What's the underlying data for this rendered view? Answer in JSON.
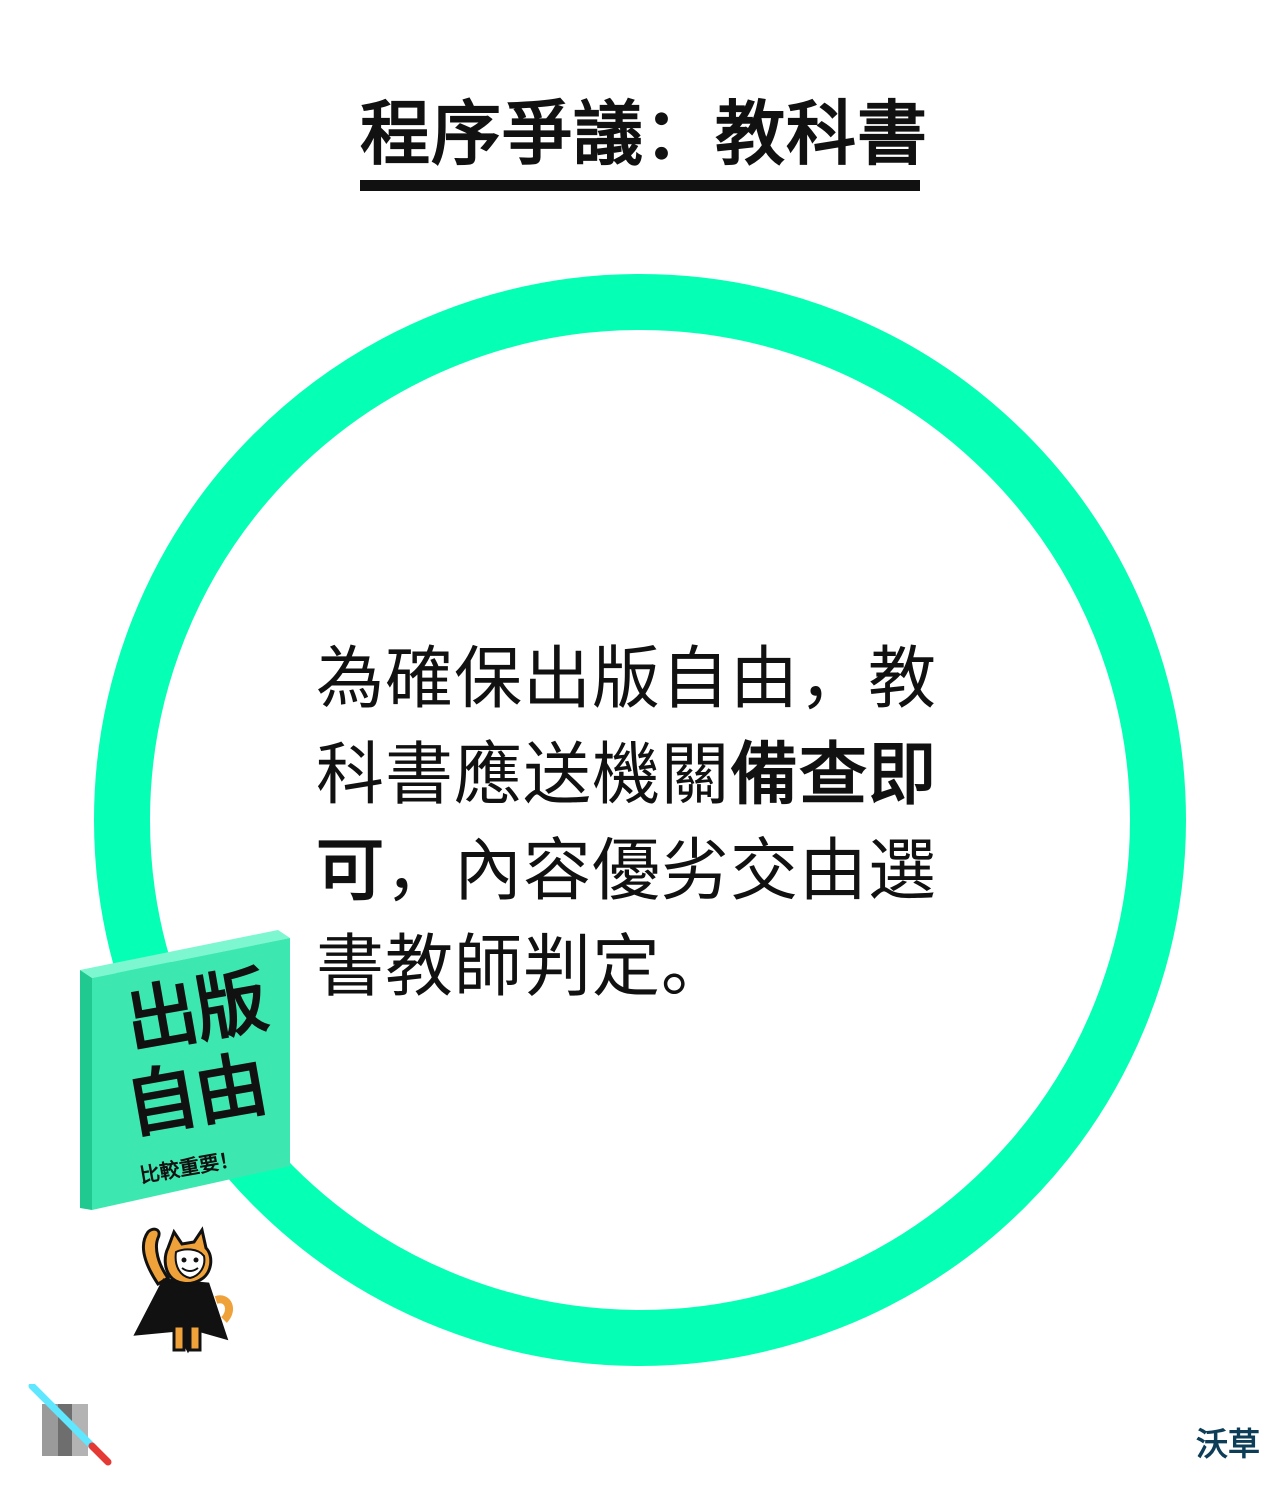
{
  "header": {
    "title": "程序爭議：教科書"
  },
  "main": {
    "statement_lines": [
      {
        "pre": "為確保出版自由，教",
        "bold": "",
        "post": ""
      },
      {
        "pre": "科書應送機關",
        "bold": "備查即",
        "post": ""
      },
      {
        "pre": "",
        "bold": "可",
        "post": "，內容優劣交由選"
      },
      {
        "pre": "書教師判定。",
        "bold": "",
        "post": ""
      }
    ]
  },
  "badge": {
    "line1": "出版",
    "line2": "自由",
    "caption": "比較重要！",
    "face_color": "#3de8b0",
    "side_color": "#1fc98f",
    "top_color": "#7cf7cf"
  },
  "colors": {
    "ring": "#05ffb4",
    "text": "#111111",
    "brand": "#0d3d57"
  },
  "icons": {
    "mascot": "cat-mascot-cape-icon",
    "left_logo": "lightsaber-logo-icon"
  },
  "footer": {
    "brand_text": "沃草"
  }
}
